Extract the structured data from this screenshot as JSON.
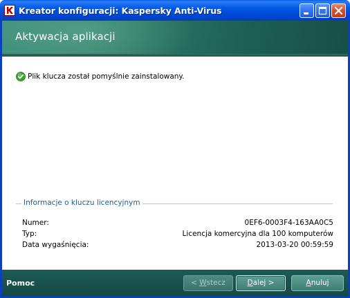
{
  "window": {
    "title": "Kreator konfiguracji: Kaspersky Anti-Virus"
  },
  "header": {
    "title": "Aktywacja aplikacji"
  },
  "status": {
    "icon": "success-check-icon",
    "message": "Plik klucza został pomyślnie zainstalowany."
  },
  "license_info": {
    "legend": "Informacje o kluczu licencyjnym",
    "rows": [
      {
        "label": "Numer:",
        "value": "0EF6-0003F4-163AA0C5"
      },
      {
        "label": "Typ:",
        "value": "Licencja komercyjna dla 100 komputerów"
      },
      {
        "label": "Data wygaśnięcia:",
        "value": "2013-03-20 00:59:59"
      }
    ]
  },
  "footer": {
    "help": "Pomoc",
    "back_mnemonic": "W",
    "back_pre": "< ",
    "back_rest": "stecz",
    "next_mnemonic": "D",
    "next_rest": "alej >",
    "cancel_mnemonic": "A",
    "cancel_rest": "nuluj"
  },
  "colors": {
    "header_band": "#2f7a68",
    "footer_band": "#1d5a55",
    "legend_text": "#1f5f8f",
    "success": "#3aa02e"
  }
}
